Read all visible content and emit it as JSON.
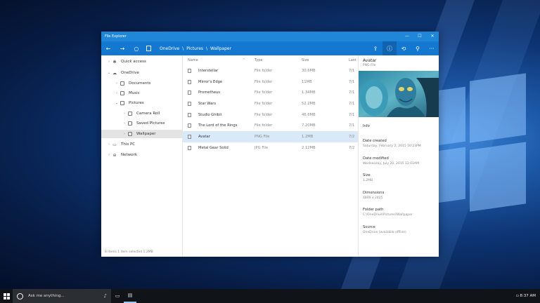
{
  "window": {
    "title": "File Explorer",
    "controls": [
      "—",
      "☐",
      "✕"
    ]
  },
  "toolbar": {
    "back_icon": "arrow-left-icon",
    "forward_icon": "arrow-right-icon",
    "refresh_icon": "refresh-icon",
    "breadcrumb": [
      "OneDrive",
      "Pictures",
      "Wallpaper"
    ],
    "separator": "\\",
    "right_icons": [
      "share-icon",
      "info-icon",
      "settings-icon",
      "search-icon",
      "more-icon"
    ]
  },
  "nav": {
    "items": [
      {
        "label": "Quick access",
        "chev": "›",
        "icon": "✱"
      },
      {
        "label": "OneDrive",
        "chev": "⌄",
        "icon": "☁"
      },
      {
        "label": "Documents",
        "chev": "›",
        "icon": "folder"
      },
      {
        "label": "Music",
        "chev": "›",
        "icon": "folder"
      },
      {
        "label": "Pictures",
        "chev": "⌄",
        "icon": "folder"
      },
      {
        "label": "Camera Roll",
        "chev": "›",
        "icon": "folder"
      },
      {
        "label": "Saved Pictures",
        "chev": "›",
        "icon": "folder"
      },
      {
        "label": "Wallpaper",
        "chev": "›",
        "icon": "folder"
      },
      {
        "label": "This PC",
        "chev": "›",
        "icon": "▭"
      },
      {
        "label": "Network",
        "chev": "›",
        "icon": "⊕"
      }
    ],
    "status": "8 items  1 item selected  1.2MB"
  },
  "list": {
    "columns": [
      "Name",
      "Type",
      "Size",
      "Last"
    ],
    "rows": [
      {
        "name": "Interstellar",
        "type": "File folder",
        "size": "30.6MB",
        "date": "7/1"
      },
      {
        "name": "Mirror's Edge",
        "type": "File folder",
        "size": "11MB",
        "date": "7/1"
      },
      {
        "name": "Prometheus",
        "type": "File folder",
        "size": "1.34MB",
        "date": "7/1"
      },
      {
        "name": "Star Wars",
        "type": "File folder",
        "size": "52.2MB",
        "date": "7/1"
      },
      {
        "name": "Studio Ghibli",
        "type": "File folder",
        "size": "46.6MB",
        "date": "7/1"
      },
      {
        "name": "The Lord of the Rings",
        "type": "File folder",
        "size": "7.20MB",
        "date": "7/1"
      },
      {
        "name": "Avatar",
        "type": "PNG File",
        "size": "1.2MB",
        "date": "7/2"
      },
      {
        "name": "Metal Gear Solid",
        "type": "JPG File",
        "size": "2.12MB",
        "date": "7/2"
      }
    ]
  },
  "details": {
    "name": "Avatar",
    "type": "PNG File",
    "info_label": "Info",
    "fields": [
      {
        "label": "Date created",
        "value": "Saturday, February 2, 2015 10:23PM"
      },
      {
        "label": "Date modified",
        "value": "Wednesday, July 20, 2015 12:01AM"
      },
      {
        "label": "Size",
        "value": "1.2MB"
      },
      {
        "label": "Dimensions",
        "value": "4849 x 2425"
      },
      {
        "label": "Folder path",
        "value": "C:\\OneDrive\\Pictures\\Wallpaper"
      },
      {
        "label": "Source",
        "value": "OneDrive (available offline)"
      }
    ]
  },
  "taskbar": {
    "search_placeholder": "Ask me anything...",
    "time": "8:37 AM"
  }
}
